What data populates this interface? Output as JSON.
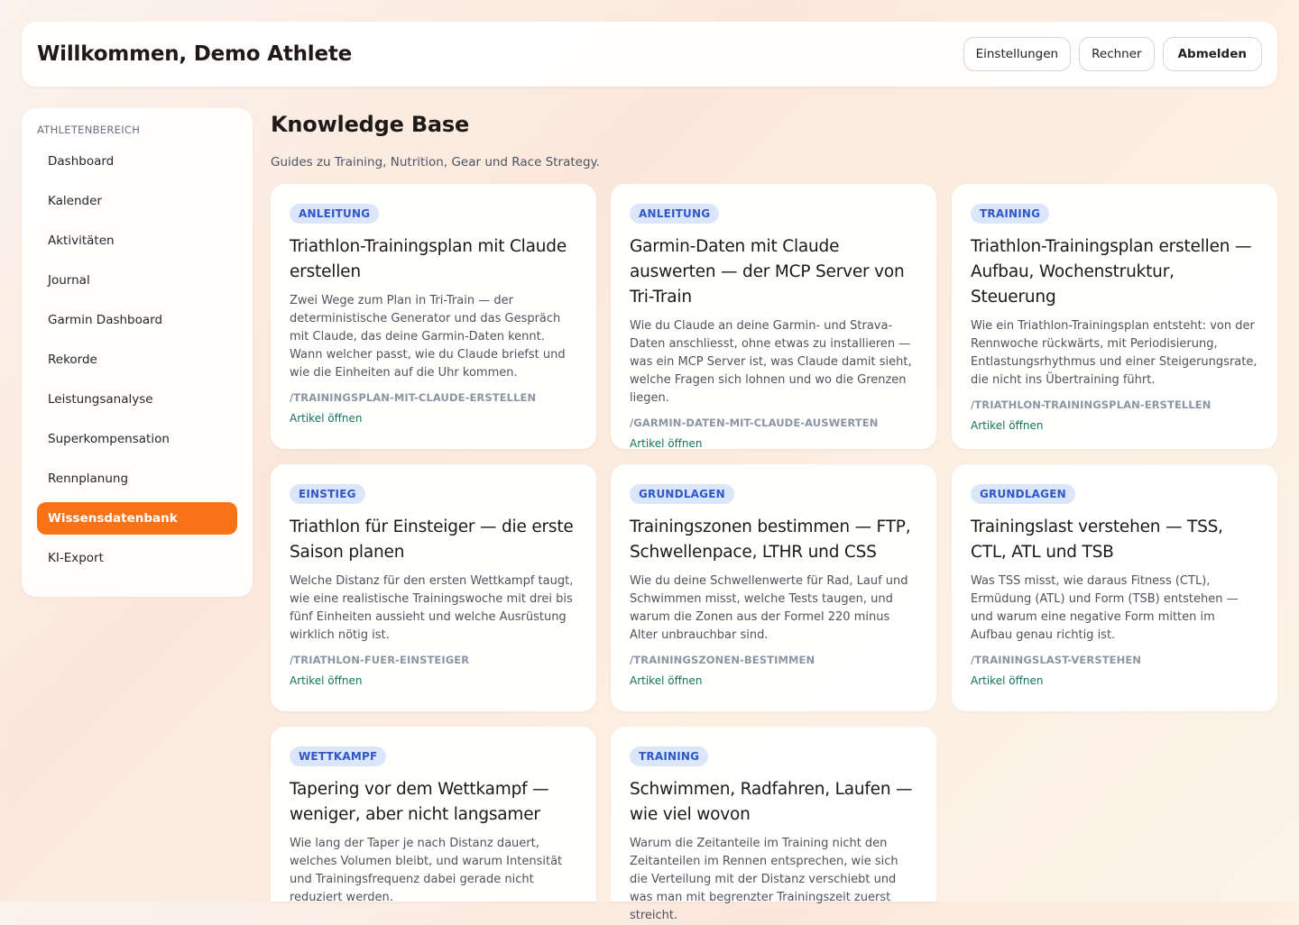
{
  "header": {
    "welcome": "Willkommen, Demo Athlete",
    "buttons": {
      "settings": "Einstellungen",
      "calculator": "Rechner",
      "logout": "Abmelden"
    }
  },
  "sidebar": {
    "heading": "ATHLETENBEREICH",
    "items": [
      {
        "label": "Dashboard"
      },
      {
        "label": "Kalender"
      },
      {
        "label": "Aktivitäten"
      },
      {
        "label": "Journal"
      },
      {
        "label": "Garmin Dashboard"
      },
      {
        "label": "Rekorde"
      },
      {
        "label": "Leistungsanalyse"
      },
      {
        "label": "Superkompensation"
      },
      {
        "label": "Rennplanung"
      },
      {
        "label": "Wissensdatenbank",
        "active": true
      },
      {
        "label": "KI-Export"
      }
    ]
  },
  "main": {
    "title": "Knowledge Base",
    "subtitle": "Guides zu Training, Nutrition, Gear und Race Strategy.",
    "cards": [
      {
        "badge": "ANLEITUNG",
        "title": "Triathlon-Trainingsplan mit Claude erstellen",
        "description": "Zwei Wege zum Plan in Tri-Train — der deterministische Generator und das Gespräch mit Claude, das deine Garmin-Daten kennt. Wann welcher passt, wie du Claude briefst und wie die Einheiten auf die Uhr kommen.",
        "slug": "/TRAININGSPLAN-MIT-CLAUDE-ERSTELLEN",
        "link": "Artikel öffnen"
      },
      {
        "badge": "ANLEITUNG",
        "title": "Garmin-Daten mit Claude auswerten — der MCP Server von Tri-Train",
        "description": "Wie du Claude an deine Garmin- und Strava-Daten anschliesst, ohne etwas zu installieren — was ein MCP Server ist, was Claude damit sieht, welche Fragen sich lohnen und wo die Grenzen liegen.",
        "slug": "/GARMIN-DATEN-MIT-CLAUDE-AUSWERTEN",
        "link": "Artikel öffnen"
      },
      {
        "badge": "TRAINING",
        "title": "Triathlon-Trainingsplan erstellen — Aufbau, Wochenstruktur, Steuerung",
        "description": "Wie ein Triathlon-Trainingsplan entsteht: von der Rennwoche rückwärts, mit Periodisierung, Entlastungsrhythmus und einer Steigerungsrate, die nicht ins Übertraining führt.",
        "slug": "/TRIATHLON-TRAININGSPLAN-ERSTELLEN",
        "link": "Artikel öffnen"
      },
      {
        "badge": "EINSTIEG",
        "title": "Triathlon für Einsteiger — die erste Saison planen",
        "description": "Welche Distanz für den ersten Wettkampf taugt, wie eine realistische Trainingswoche mit drei bis fünf Einheiten aussieht und welche Ausrüstung wirklich nötig ist.",
        "slug": "/TRIATHLON-FUER-EINSTEIGER",
        "link": "Artikel öffnen"
      },
      {
        "badge": "GRUNDLAGEN",
        "title": "Trainingszonen bestimmen — FTP, Schwellenpace, LTHR und CSS",
        "description": "Wie du deine Schwellenwerte für Rad, Lauf und Schwimmen misst, welche Tests taugen, und warum die Zonen aus der Formel 220 minus Alter unbrauchbar sind.",
        "slug": "/TRAININGSZONEN-BESTIMMEN",
        "link": "Artikel öffnen"
      },
      {
        "badge": "GRUNDLAGEN",
        "title": "Trainingslast verstehen — TSS, CTL, ATL und TSB",
        "description": "Was TSS misst, wie daraus Fitness (CTL), Ermüdung (ATL) und Form (TSB) entstehen — und warum eine negative Form mitten im Aufbau genau richtig ist.",
        "slug": "/TRAININGSLAST-VERSTEHEN",
        "link": "Artikel öffnen"
      },
      {
        "badge": "WETTKAMPF",
        "title": "Tapering vor dem Wettkampf — weniger, aber nicht langsamer",
        "description": "Wie lang der Taper je nach Distanz dauert, welches Volumen bleibt, und warum Intensität und Trainingsfrequenz dabei gerade nicht reduziert werden.",
        "slug": "",
        "link": ""
      },
      {
        "badge": "TRAINING",
        "title": "Schwimmen, Radfahren, Laufen — wie viel wovon",
        "description": "Warum die Zeitanteile im Training nicht den Zeitanteilen im Rennen entsprechen, wie sich die Verteilung mit der Distanz verschiebt und was man mit begrenzter Trainingszeit zuerst streicht.",
        "slug": "",
        "link": ""
      }
    ]
  }
}
